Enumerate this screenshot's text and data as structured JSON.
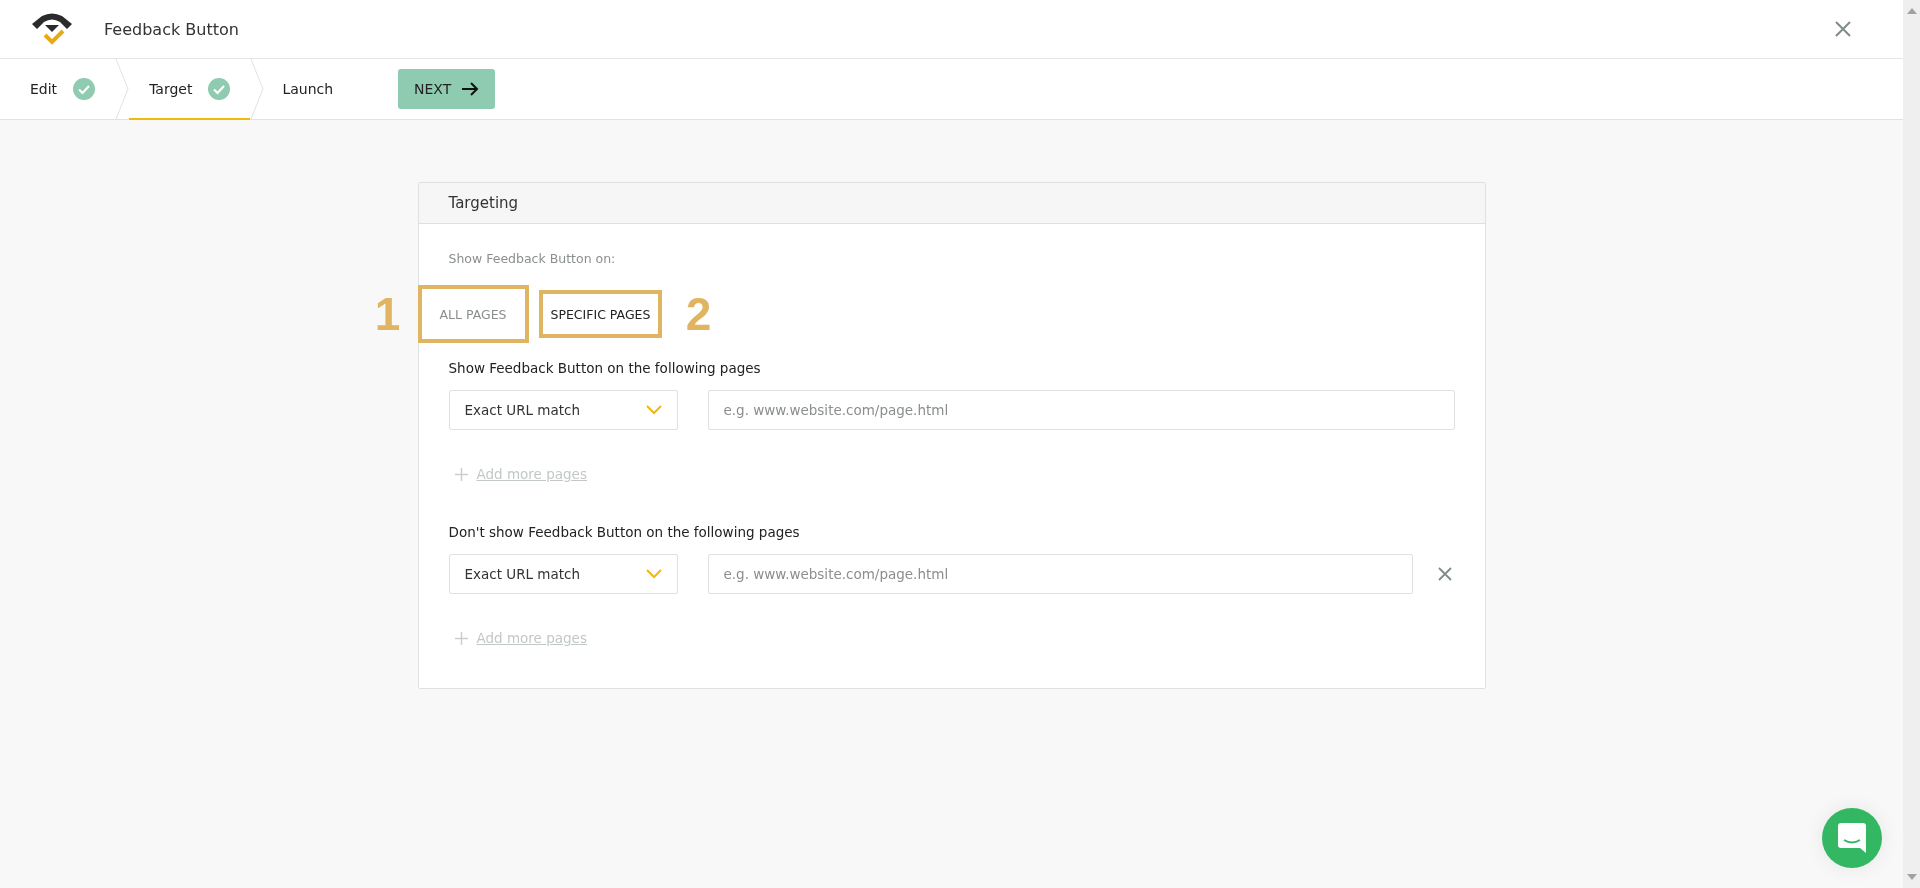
{
  "header": {
    "title": "Feedback Button"
  },
  "steps": [
    {
      "label": "Edit",
      "done": true,
      "selected": false
    },
    {
      "label": "Target",
      "done": true,
      "selected": true
    },
    {
      "label": "Launch",
      "done": false,
      "selected": false
    }
  ],
  "next_button": "NEXT",
  "card": {
    "title": "Targeting",
    "intro": "Show Feedback Button on:",
    "tabs": [
      {
        "label": "ALL PAGES",
        "selected": false,
        "annotation": "1"
      },
      {
        "label": "SPECIFIC PAGES",
        "selected": true,
        "annotation": "2"
      }
    ],
    "sections": [
      {
        "heading": "Show Feedback Button on the following pages",
        "rules": [
          {
            "match": "Exact URL match",
            "placeholder": "e.g. www.website.com/page.html",
            "removable": false
          }
        ],
        "add_link": "Add more pages"
      },
      {
        "heading": "Don't show Feedback Button on the following pages",
        "rules": [
          {
            "match": "Exact URL match",
            "placeholder": "e.g. www.website.com/page.html",
            "removable": true
          }
        ],
        "add_link": "Add more pages"
      }
    ]
  }
}
